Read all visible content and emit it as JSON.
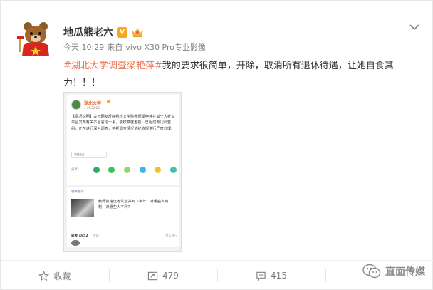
{
  "post": {
    "author_name": "地瓜熊老六",
    "verified_badge": "V",
    "time": "今天 10:29",
    "source_prefix": "来自",
    "source": "vivo X30 Pro专业影像",
    "hashtag": "#湖北大学调查梁艳萍#",
    "body": "我的要求很简单，开除，取消所有退休待遇，让她自食其力！！！"
  },
  "embedded_screenshot": {
    "account_name": "湖北大学",
    "date": "4-26 22:23",
    "notice": "【情况说明】关于网友反映我校文学院教师梁艳萍在其个人社交平台发布有关不当言论一事，学校高度重视，已组成专门调查组，正在进行深入调查，将视调查情况依纪依规进行严肃处理。",
    "fold_label": "收起全文",
    "share_label": "分享",
    "related_label": "相关推荐",
    "related_text": "教师资格证考试合并到下半年：对哪些人有利，对哪些人不利？",
    "repost_tab": "转发 4952",
    "comment_tab": "评论",
    "like_tab": "赞",
    "likes_count": "赞 1.9万"
  },
  "actions": {
    "favorite_label": "收藏",
    "repost_count": "479",
    "comment_count": "415"
  },
  "watermark": {
    "text": "直面传媒"
  },
  "colors": {
    "hashtag": "#eb7350",
    "verified": "#f5a623",
    "text": "#333333",
    "meta": "#808080"
  }
}
